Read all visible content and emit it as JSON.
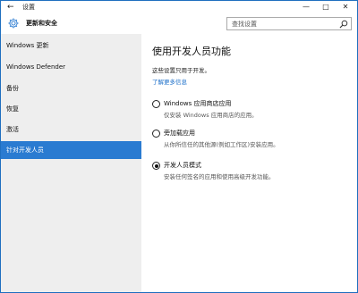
{
  "titlebar": {
    "back_glyph": "←",
    "title": "设置",
    "minimize_glyph": "—",
    "maximize_glyph": "□",
    "close_glyph": "✕"
  },
  "header": {
    "icon": "gear-icon",
    "title": "更新和安全",
    "search_placeholder": "查找设置",
    "search_icon": "search-icon"
  },
  "sidebar": {
    "items": [
      {
        "label": "Windows 更新",
        "active": false
      },
      {
        "label": "Windows Defender",
        "active": false
      },
      {
        "label": "备份",
        "active": false
      },
      {
        "label": "恢复",
        "active": false
      },
      {
        "label": "激活",
        "active": false
      },
      {
        "label": "针对开发人员",
        "active": true
      }
    ]
  },
  "main": {
    "title": "使用开发人员功能",
    "description": "这些设置只用于开发。",
    "learn_more": "了解更多信息",
    "options": [
      {
        "label": "Windows 应用商店应用",
        "desc": "仅安装 Windows 应用商店的应用。",
        "selected": false
      },
      {
        "label": "旁加载应用",
        "desc": "从你所信任的其他源(例如工作区)安装应用。",
        "selected": false
      },
      {
        "label": "开发人员模式",
        "desc": "安装任何签名的应用和使用高级开发功能。",
        "selected": true
      }
    ]
  },
  "colors": {
    "accent": "#2a7bd1",
    "sidebar_bg": "#eeeeee",
    "link": "#1a6ec9",
    "window_border": "#1f6fbf"
  }
}
